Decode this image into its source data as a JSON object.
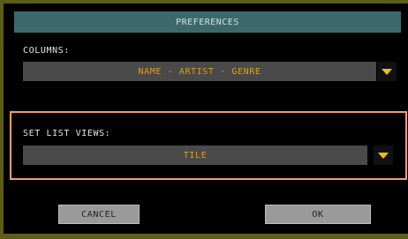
{
  "dialog": {
    "title": "PREFERENCES"
  },
  "columns": {
    "label": "COLUMNS:",
    "value": "NAME - ARTIST - GENRE"
  },
  "set_list_views": {
    "label": "SET LIST VIEWS:",
    "value": "TILE"
  },
  "buttons": {
    "cancel": "CANCEL",
    "ok": "OK"
  },
  "colors": {
    "title_bar": "#3c6a6c",
    "dropdown_text": "#d9a020",
    "arrow": "#f0c000",
    "highlight": "#f0a070",
    "frame": "#5d5d1a"
  },
  "icons": {
    "dropdown_arrow": "chevron-down-icon"
  }
}
